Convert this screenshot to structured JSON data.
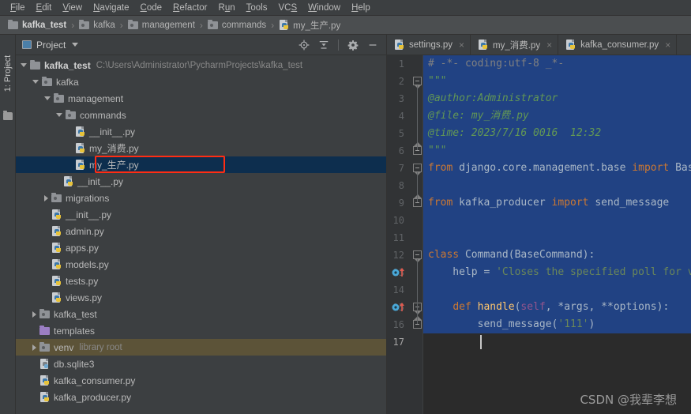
{
  "menubar": {
    "items": [
      {
        "label": "File",
        "mnemonic": "F"
      },
      {
        "label": "Edit",
        "mnemonic": "E"
      },
      {
        "label": "View",
        "mnemonic": "V"
      },
      {
        "label": "Navigate",
        "mnemonic": "N"
      },
      {
        "label": "Code",
        "mnemonic": "C"
      },
      {
        "label": "Refactor",
        "mnemonic": "R"
      },
      {
        "label": "Run",
        "mnemonic": "u"
      },
      {
        "label": "Tools",
        "mnemonic": "T"
      },
      {
        "label": "VCS",
        "mnemonic": "S"
      },
      {
        "label": "Window",
        "mnemonic": "W"
      },
      {
        "label": "Help",
        "mnemonic": "H"
      }
    ]
  },
  "breadcrumb": {
    "separator": "›",
    "items": [
      {
        "label": "kafka_test",
        "icon": "folder-icon",
        "bold": true
      },
      {
        "label": "kafka",
        "icon": "module-folder-icon",
        "bold": false
      },
      {
        "label": "management",
        "icon": "module-folder-icon",
        "bold": false
      },
      {
        "label": "commands",
        "icon": "module-folder-icon",
        "bold": false
      },
      {
        "label": "my_生产.py",
        "icon": "python-file-icon",
        "bold": false
      }
    ]
  },
  "toolwindow_strip": {
    "label": "1: Project",
    "folder_icon": "folder-icon"
  },
  "project_panel": {
    "title": "Project",
    "title_icon": "project-icon",
    "dropdown_icon": "chevron-down-icon",
    "tools": [
      {
        "name": "locate-icon",
        "title": "Select Opened File"
      },
      {
        "name": "collapse-all-icon",
        "title": "Collapse All"
      },
      {
        "name": "gear-icon",
        "title": "Settings"
      },
      {
        "name": "minimize-icon",
        "title": "Hide"
      }
    ],
    "tree": [
      {
        "label": "kafka_test",
        "sub": "C:\\Users\\Administrator\\PycharmProjects\\kafka_test",
        "indent": 0,
        "arrow": "open",
        "icon": "folder-icon",
        "bold": true,
        "state": "normal"
      },
      {
        "label": "kafka",
        "sub": "",
        "indent": 1,
        "arrow": "open",
        "icon": "module-folder-icon",
        "bold": false,
        "state": "normal"
      },
      {
        "label": "management",
        "sub": "",
        "indent": 2,
        "arrow": "open",
        "icon": "module-folder-icon",
        "bold": false,
        "state": "normal"
      },
      {
        "label": "commands",
        "sub": "",
        "indent": 3,
        "arrow": "open",
        "icon": "module-folder-icon",
        "bold": false,
        "state": "normal"
      },
      {
        "label": "__init__.py",
        "sub": "",
        "indent": 4,
        "arrow": "none",
        "icon": "python-file-icon",
        "bold": false,
        "state": "normal"
      },
      {
        "label": "my_消费.py",
        "sub": "",
        "indent": 4,
        "arrow": "none",
        "icon": "python-file-icon",
        "bold": false,
        "state": "normal"
      },
      {
        "label": "my_生产.py",
        "sub": "",
        "indent": 4,
        "arrow": "none",
        "icon": "python-file-icon",
        "bold": false,
        "state": "selected"
      },
      {
        "label": "__init__.py",
        "sub": "",
        "indent": 3,
        "arrow": "none",
        "icon": "python-file-icon",
        "bold": false,
        "state": "normal"
      },
      {
        "label": "migrations",
        "sub": "",
        "indent": 2,
        "arrow": "closed",
        "icon": "module-folder-icon",
        "bold": false,
        "state": "normal"
      },
      {
        "label": "__init__.py",
        "sub": "",
        "indent": 2,
        "arrow": "none",
        "icon": "python-file-icon",
        "bold": false,
        "state": "normal"
      },
      {
        "label": "admin.py",
        "sub": "",
        "indent": 2,
        "arrow": "none",
        "icon": "python-file-icon",
        "bold": false,
        "state": "normal"
      },
      {
        "label": "apps.py",
        "sub": "",
        "indent": 2,
        "arrow": "none",
        "icon": "python-file-icon",
        "bold": false,
        "state": "normal"
      },
      {
        "label": "models.py",
        "sub": "",
        "indent": 2,
        "arrow": "none",
        "icon": "python-file-icon",
        "bold": false,
        "state": "normal"
      },
      {
        "label": "tests.py",
        "sub": "",
        "indent": 2,
        "arrow": "none",
        "icon": "python-file-icon",
        "bold": false,
        "state": "normal"
      },
      {
        "label": "views.py",
        "sub": "",
        "indent": 2,
        "arrow": "none",
        "icon": "python-file-icon",
        "bold": false,
        "state": "normal"
      },
      {
        "label": "kafka_test",
        "sub": "",
        "indent": 1,
        "arrow": "closed",
        "icon": "module-folder-icon",
        "bold": false,
        "state": "normal"
      },
      {
        "label": "templates",
        "sub": "",
        "indent": 1,
        "arrow": "none",
        "icon": "templates-folder-icon",
        "bold": false,
        "state": "normal"
      },
      {
        "label": "venv",
        "sub": "library root",
        "indent": 1,
        "arrow": "closed",
        "icon": "module-folder-icon",
        "bold": false,
        "state": "highlighted"
      },
      {
        "label": "db.sqlite3",
        "sub": "",
        "indent": 1,
        "arrow": "none",
        "icon": "db-file-icon",
        "bold": false,
        "state": "normal"
      },
      {
        "label": "kafka_consumer.py",
        "sub": "",
        "indent": 1,
        "arrow": "none",
        "icon": "python-file-icon",
        "bold": false,
        "state": "normal"
      },
      {
        "label": "kafka_producer.py",
        "sub": "",
        "indent": 1,
        "arrow": "none",
        "icon": "python-file-icon",
        "bold": false,
        "state": "normal"
      }
    ]
  },
  "editor": {
    "tabs": [
      {
        "label": "settings.py",
        "icon": "python-file-icon",
        "close": "×",
        "active": false
      },
      {
        "label": "my_消费.py",
        "icon": "python-file-icon",
        "close": "×",
        "active": false
      },
      {
        "label": "kafka_consumer.py",
        "icon": "python-file-icon",
        "close": "×",
        "active": false
      }
    ],
    "line_numbers": [
      "1",
      "2",
      "3",
      "4",
      "5",
      "6",
      "7",
      "8",
      "9",
      "10",
      "11",
      "12",
      "13",
      "14",
      "15",
      "16",
      "17"
    ],
    "current_line": 17,
    "selection_color": "#214283",
    "gutter_icons": [
      {
        "line": 13,
        "name": "override-method-icon"
      },
      {
        "line": 15,
        "name": "override-method-icon"
      }
    ],
    "lines": [
      {
        "n": 1,
        "tokens": [
          {
            "t": "# -*- coding:utf-8 _*-",
            "c": "cm"
          }
        ]
      },
      {
        "n": 2,
        "tokens": [
          {
            "t": "\"\"\"",
            "c": "doc"
          }
        ]
      },
      {
        "n": 3,
        "tokens": [
          {
            "t": "@author:Administrator",
            "c": "doc"
          }
        ]
      },
      {
        "n": 4,
        "tokens": [
          {
            "t": "@file: my_消费.py",
            "c": "doc"
          }
        ]
      },
      {
        "n": 5,
        "tokens": [
          {
            "t": "@time: 2023/7/16 0016  12:32",
            "c": "doc"
          }
        ]
      },
      {
        "n": 6,
        "tokens": [
          {
            "t": "\"\"\"",
            "c": "doc"
          }
        ]
      },
      {
        "n": 7,
        "tokens": [
          {
            "t": "from",
            "c": "kw"
          },
          {
            "t": " django.core.management.base ",
            "c": "ident"
          },
          {
            "t": "import",
            "c": "kw"
          },
          {
            "t": " BaseCommand",
            "c": "ident"
          }
        ]
      },
      {
        "n": 8,
        "tokens": []
      },
      {
        "n": 9,
        "tokens": [
          {
            "t": "from",
            "c": "kw"
          },
          {
            "t": " kafka_producer ",
            "c": "ident"
          },
          {
            "t": "import",
            "c": "kw"
          },
          {
            "t": " send_message",
            "c": "ident"
          }
        ]
      },
      {
        "n": 10,
        "tokens": []
      },
      {
        "n": 11,
        "tokens": []
      },
      {
        "n": 12,
        "tokens": [
          {
            "t": "class",
            "c": "kw"
          },
          {
            "t": " Command(BaseCommand):",
            "c": "ident"
          }
        ]
      },
      {
        "n": 13,
        "tokens": [
          {
            "t": "    help = ",
            "c": "ident"
          },
          {
            "t": "'Closes the specified poll for voting'",
            "c": "str"
          }
        ]
      },
      {
        "n": 14,
        "tokens": []
      },
      {
        "n": 15,
        "tokens": [
          {
            "t": "    ",
            "c": "ident"
          },
          {
            "t": "def",
            "c": "kw"
          },
          {
            "t": " ",
            "c": "ident"
          },
          {
            "t": "handle",
            "c": "fn"
          },
          {
            "t": "(",
            "c": "ident"
          },
          {
            "t": "self",
            "c": "self"
          },
          {
            "t": ", *args, **options):",
            "c": "ident"
          }
        ]
      },
      {
        "n": 16,
        "tokens": [
          {
            "t": "        send_message(",
            "c": "ident"
          },
          {
            "t": "'111'",
            "c": "str"
          },
          {
            "t": ")",
            "c": "ident"
          }
        ]
      },
      {
        "n": 17,
        "tokens": []
      }
    ],
    "watermark": "CSDN @我辈李想"
  },
  "colors": {
    "chrome": "#3c3f41",
    "editor_bg": "#2b2b2b",
    "gutter_bg": "#313335",
    "selection": "#214283",
    "tree_selected": "#0d2e4e",
    "tree_highlight": "#5c5338",
    "annotation_red": "#ff2d13",
    "keyword": "#cc7832",
    "docstring": "#629755",
    "string": "#6a8759",
    "identifier": "#a9b7c6"
  }
}
